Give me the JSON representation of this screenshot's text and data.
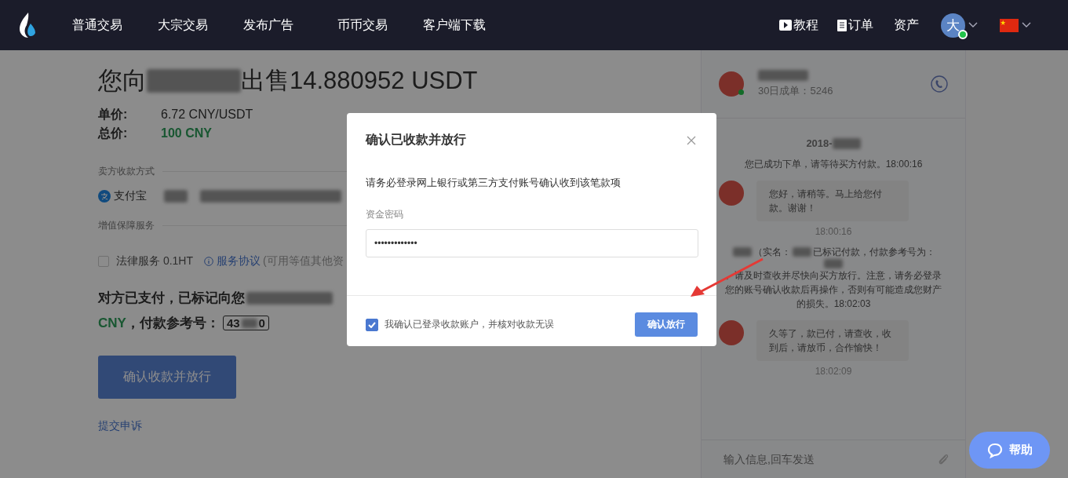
{
  "nav": {
    "items": [
      "普通交易",
      "大宗交易",
      "发布广告",
      "币币交易",
      "客户端下载"
    ],
    "tutorial": "教程",
    "orders": "订单",
    "assets": "资产",
    "avatar": "大",
    "online": true
  },
  "order": {
    "title_prefix": "您向",
    "title_suffix": "出售14.880952 USDT",
    "price_label": "单价:",
    "price": "6.72 CNY/USDT",
    "total_label": "总价:",
    "total": "100 CNY",
    "payment_section": "卖方收款方式",
    "payment_method": "支付宝",
    "service_section": "增值保障服务",
    "legal": {
      "label": "法律服务 0.1HT",
      "checked": false,
      "link": "服务协议",
      "note": "(可用等值其他资"
    },
    "status_text": "对方已支付，已标记向您",
    "status_currency": "CNY",
    "status_ref_label": "，付款参考号：",
    "ref_parts": [
      "43",
      "0"
    ],
    "release_button": "确认收款并放行",
    "appeal_link": "提交申诉"
  },
  "chat": {
    "orders_30d": "30日成单：5246",
    "online": true,
    "date": "2018-",
    "messages": [
      {
        "kind": "system",
        "text": "您已成功下单，请等待买方付款。18:00:16"
      },
      {
        "kind": "bubble",
        "text": "您好，请稍等。马上给您付款。谢谢！",
        "time": "18:00:16"
      },
      {
        "kind": "system_redacted",
        "parts": [
          "（实名：",
          "已标记付款，付款参考号为：",
          "。请及时查收并尽快向买方放行。注意，请务必登录您的账号确认收款后再操作，否则有可能造成您财产的损失。18:02:03"
        ]
      },
      {
        "kind": "bubble",
        "text": "久等了，款已付，请查收，收到后，请放币，合作愉快！",
        "time": "18:02:09"
      }
    ],
    "input_placeholder": "输入信息,回车发送"
  },
  "dialog": {
    "title": "确认已收款并放行",
    "description": "请务必登录网上银行或第三方支付账号确认收到该笔款项",
    "password_label": "资金密码",
    "password_value": "•••••••••••••",
    "confirm": {
      "label": "我确认已登录收款账户，并核对收款无误",
      "checked": true
    },
    "button": "确认放行"
  },
  "help_button": "帮助"
}
